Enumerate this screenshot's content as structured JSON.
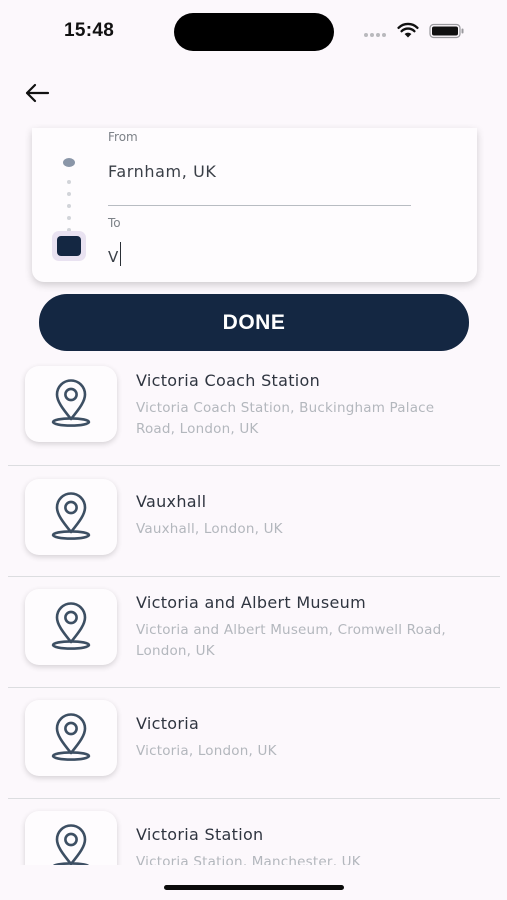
{
  "status_bar": {
    "time": "15:48"
  },
  "icons": {
    "back": "arrow-left-icon",
    "wifi": "wifi-icon",
    "battery": "battery-icon",
    "pin": "map-pin-icon"
  },
  "colors": {
    "primary": "#142742",
    "background": "#fcf8fc",
    "secondary_text": "#b3b7bd"
  },
  "route": {
    "from_label": "From",
    "from_value": "Farnham, UK",
    "to_label": "To",
    "to_value": "V"
  },
  "done_label": "DONE",
  "results": [
    {
      "name": "Victoria Coach Station",
      "address": "Victoria Coach Station, Buckingham Palace Road, London, UK"
    },
    {
      "name": "Vauxhall",
      "address": "Vauxhall, London, UK"
    },
    {
      "name": "Victoria and Albert Museum",
      "address": "Victoria and Albert Museum, Cromwell Road, London, UK"
    },
    {
      "name": "Victoria",
      "address": "Victoria, London, UK"
    },
    {
      "name": "Victoria Station",
      "address": "Victoria Station, Manchester, UK"
    }
  ]
}
